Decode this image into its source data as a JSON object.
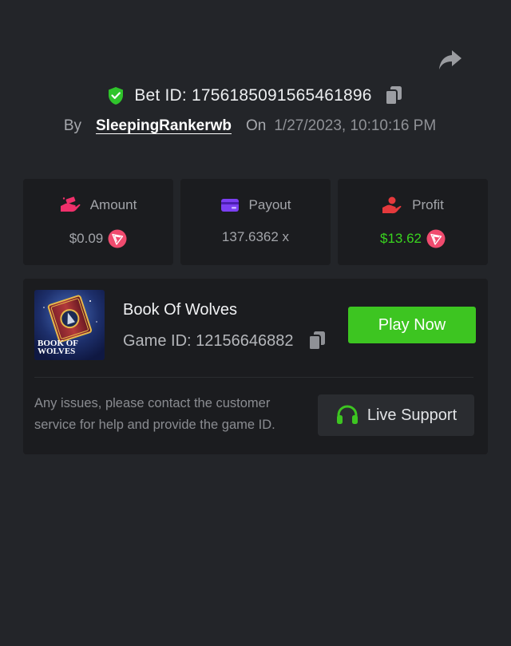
{
  "header": {
    "bet_id_label": "Bet ID: 1756185091565461896",
    "by_label": "By",
    "username": "SleepingRankerwb",
    "on_label": "On",
    "date": "1/27/2023, 10:10:16 PM"
  },
  "stats": {
    "amount": {
      "label": "Amount",
      "value": "$0.09",
      "icon": "money-hand-icon",
      "coin": "tron-coin-icon"
    },
    "payout": {
      "label": "Payout",
      "value": "137.6362 x",
      "icon": "card-icon"
    },
    "profit": {
      "label": "Profit",
      "value": "$13.62",
      "icon": "profit-hand-icon",
      "coin": "tron-coin-icon"
    }
  },
  "game": {
    "title": "Book Of Wolves",
    "game_id_label": "Game ID: 12156646882",
    "thumbnail_text_line1": "BOOK OF",
    "thumbnail_text_line2": "WOLVES",
    "play_label": "Play Now"
  },
  "support": {
    "text": "Any issues, please contact the customer service for help and provide the game ID.",
    "button_label": "Live Support"
  },
  "colors": {
    "background": "#232529",
    "card": "#1b1c1f",
    "accent_green": "#3dc521",
    "profit_green": "#39d41f",
    "amount_pink": "#f0306b",
    "payout_purple": "#7b3ff2",
    "profit_red": "#e5393c"
  }
}
